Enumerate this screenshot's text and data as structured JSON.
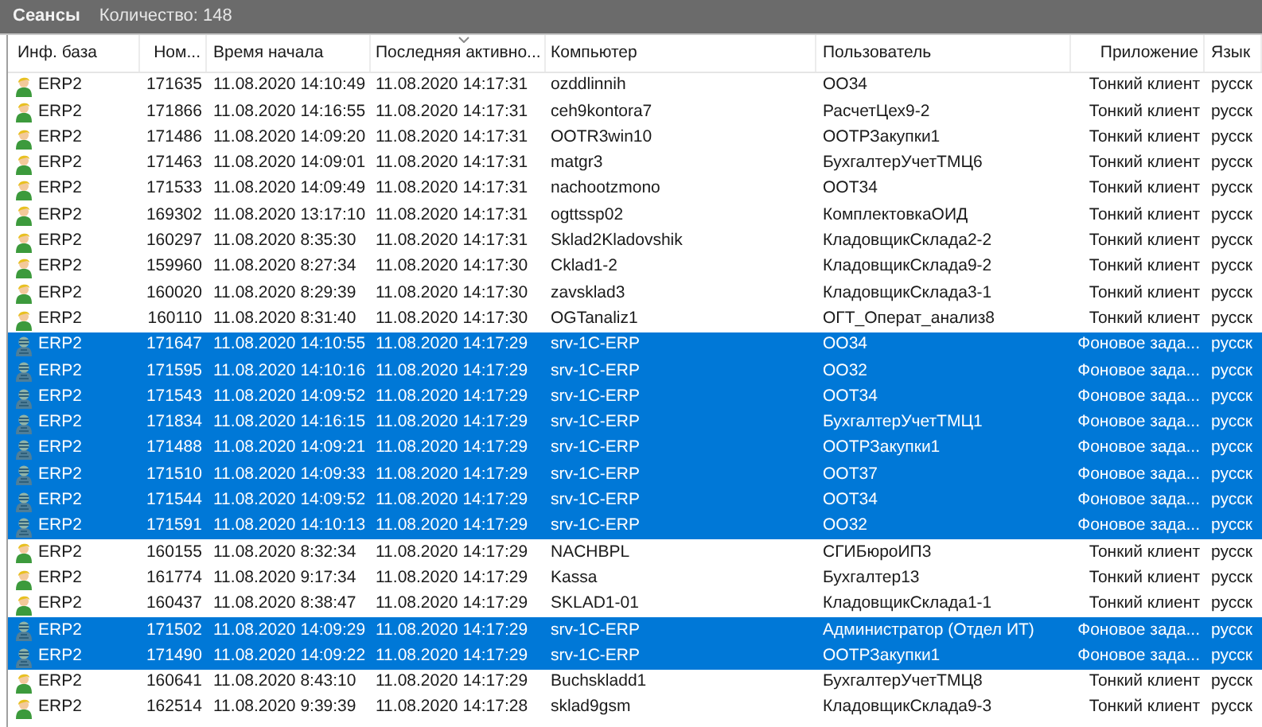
{
  "panel": {
    "title": "Сеансы",
    "count": "Количество: 148"
  },
  "table": {
    "columns": [
      {
        "label": "Инф. база",
        "sorted": false
      },
      {
        "label": "Ном...",
        "sorted": false
      },
      {
        "label": "Время начала",
        "sorted": false
      },
      {
        "label": "Последняя активно...",
        "sorted": true
      },
      {
        "label": "Компьютер",
        "sorted": false
      },
      {
        "label": "Пользователь",
        "sorted": false
      },
      {
        "label": "Приложение",
        "sorted": false
      },
      {
        "label": "Язык",
        "sorted": false
      }
    ],
    "rows": [
      {
        "kind": "user",
        "selected": false,
        "cells": [
          "ERP2",
          "171635",
          "11.08.2020 14:10:49",
          "11.08.2020 14:17:31",
          "ozddlinnih",
          "ОО34",
          "Тонкий клиент",
          "русск"
        ]
      },
      {
        "kind": "user",
        "selected": false,
        "cells": [
          "ERP2",
          "171866",
          "11.08.2020 14:16:55",
          "11.08.2020 14:17:31",
          "ceh9kontora7",
          "РасчетЦех9-2",
          "Тонкий клиент",
          "русск"
        ]
      },
      {
        "kind": "user",
        "selected": false,
        "cells": [
          "ERP2",
          "171486",
          "11.08.2020 14:09:20",
          "11.08.2020 14:17:31",
          "OOTR3win10",
          "ООТРЗакупки1",
          "Тонкий клиент",
          "русск"
        ]
      },
      {
        "kind": "user",
        "selected": false,
        "cells": [
          "ERP2",
          "171463",
          "11.08.2020 14:09:01",
          "11.08.2020 14:17:31",
          "matgr3",
          "БухгалтерУчетТМЦ6",
          "Тонкий клиент",
          "русск"
        ]
      },
      {
        "kind": "user",
        "selected": false,
        "cells": [
          "ERP2",
          "171533",
          "11.08.2020 14:09:49",
          "11.08.2020 14:17:31",
          "nachootzmono",
          "ООТ34",
          "Тонкий клиент",
          "русск"
        ]
      },
      {
        "kind": "user",
        "selected": false,
        "cells": [
          "ERP2",
          "169302",
          "11.08.2020 13:17:10",
          "11.08.2020 14:17:31",
          "ogttssp02",
          "КомплектовкаОИД",
          "Тонкий клиент",
          "русск"
        ]
      },
      {
        "kind": "user",
        "selected": false,
        "cells": [
          "ERP2",
          "160297",
          "11.08.2020 8:35:30",
          "11.08.2020 14:17:31",
          "Sklad2Kladovshik",
          "КладовщикСклада2-2",
          "Тонкий клиент",
          "русск"
        ]
      },
      {
        "kind": "user",
        "selected": false,
        "cells": [
          "ERP2",
          "159960",
          "11.08.2020 8:27:34",
          "11.08.2020 14:17:30",
          "Cklad1-2",
          "КладовщикСклада9-2",
          "Тонкий клиент",
          "русск"
        ]
      },
      {
        "kind": "user",
        "selected": false,
        "cells": [
          "ERP2",
          "160020",
          "11.08.2020 8:29:39",
          "11.08.2020 14:17:30",
          "zavsklad3",
          "КладовщикСклада3-1",
          "Тонкий клиент",
          "русск"
        ]
      },
      {
        "kind": "user",
        "selected": false,
        "cells": [
          "ERP2",
          "160110",
          "11.08.2020 8:31:40",
          "11.08.2020 14:17:30",
          "OGTanaliz1",
          "ОГТ_Операт_анализ8",
          "Тонкий клиент",
          "русск"
        ]
      },
      {
        "kind": "background",
        "selected": true,
        "cells": [
          "ERP2",
          "171647",
          "11.08.2020 14:10:55",
          "11.08.2020 14:17:29",
          "srv-1C-ERP",
          "ОО34",
          "Фоновое зада...",
          "русск"
        ]
      },
      {
        "kind": "background",
        "selected": true,
        "cells": [
          "ERP2",
          "171595",
          "11.08.2020 14:10:16",
          "11.08.2020 14:17:29",
          "srv-1C-ERP",
          "ОО32",
          "Фоновое зада...",
          "русск"
        ]
      },
      {
        "kind": "background",
        "selected": true,
        "cells": [
          "ERP2",
          "171543",
          "11.08.2020 14:09:52",
          "11.08.2020 14:17:29",
          "srv-1C-ERP",
          "ООТ34",
          "Фоновое зада...",
          "русск"
        ]
      },
      {
        "kind": "background",
        "selected": true,
        "cells": [
          "ERP2",
          "171834",
          "11.08.2020 14:16:15",
          "11.08.2020 14:17:29",
          "srv-1C-ERP",
          "БухгалтерУчетТМЦ1",
          "Фоновое зада...",
          "русск"
        ]
      },
      {
        "kind": "background",
        "selected": true,
        "cells": [
          "ERP2",
          "171488",
          "11.08.2020 14:09:21",
          "11.08.2020 14:17:29",
          "srv-1C-ERP",
          "ООТРЗакупки1",
          "Фоновое зада...",
          "русск"
        ]
      },
      {
        "kind": "background",
        "selected": true,
        "cells": [
          "ERP2",
          "171510",
          "11.08.2020 14:09:33",
          "11.08.2020 14:17:29",
          "srv-1C-ERP",
          "ООТ37",
          "Фоновое зада...",
          "русск"
        ]
      },
      {
        "kind": "background",
        "selected": true,
        "cells": [
          "ERP2",
          "171544",
          "11.08.2020 14:09:52",
          "11.08.2020 14:17:29",
          "srv-1C-ERP",
          "ООТ34",
          "Фоновое зада...",
          "русск"
        ]
      },
      {
        "kind": "background",
        "selected": true,
        "cells": [
          "ERP2",
          "171591",
          "11.08.2020 14:10:13",
          "11.08.2020 14:17:29",
          "srv-1C-ERP",
          "ОО32",
          "Фоновое зада...",
          "русск"
        ]
      },
      {
        "kind": "user",
        "selected": false,
        "cells": [
          "ERP2",
          "160155",
          "11.08.2020 8:32:34",
          "11.08.2020 14:17:29",
          "NACHBPL",
          "СГИБюроИП3",
          "Тонкий клиент",
          "русск"
        ]
      },
      {
        "kind": "user",
        "selected": false,
        "cells": [
          "ERP2",
          "161774",
          "11.08.2020 9:17:34",
          "11.08.2020 14:17:29",
          "Kassa",
          "Бухгалтер13",
          "Тонкий клиент",
          "русск"
        ]
      },
      {
        "kind": "user",
        "selected": false,
        "cells": [
          "ERP2",
          "160437",
          "11.08.2020 8:38:47",
          "11.08.2020 14:17:29",
          "SKLAD1-01",
          "КладовщикСклада1-1",
          "Тонкий клиент",
          "русск"
        ]
      },
      {
        "kind": "background",
        "selected": true,
        "cells": [
          "ERP2",
          "171502",
          "11.08.2020 14:09:29",
          "11.08.2020 14:17:29",
          "srv-1C-ERP",
          "Администратор (Отдел ИТ)",
          "Фоновое зада...",
          "русск"
        ]
      },
      {
        "kind": "background",
        "selected": true,
        "cells": [
          "ERP2",
          "171490",
          "11.08.2020 14:09:22",
          "11.08.2020 14:17:29",
          "srv-1C-ERP",
          "ООТРЗакупки1",
          "Фоновое зада...",
          "русск"
        ]
      },
      {
        "kind": "user",
        "selected": false,
        "cells": [
          "ERP2",
          "160641",
          "11.08.2020 8:43:10",
          "11.08.2020 14:17:29",
          "Buchskladd1",
          "БухгалтерУчетТМЦ8",
          "Тонкий клиент",
          "русск"
        ]
      },
      {
        "kind": "user",
        "selected": false,
        "cells": [
          "ERP2",
          "162514",
          "11.08.2020 9:39:39",
          "11.08.2020 14:17:28",
          "sklad9gsm",
          "КладовщикСклада9-3",
          "Тонкий клиент",
          "русск"
        ]
      }
    ]
  }
}
